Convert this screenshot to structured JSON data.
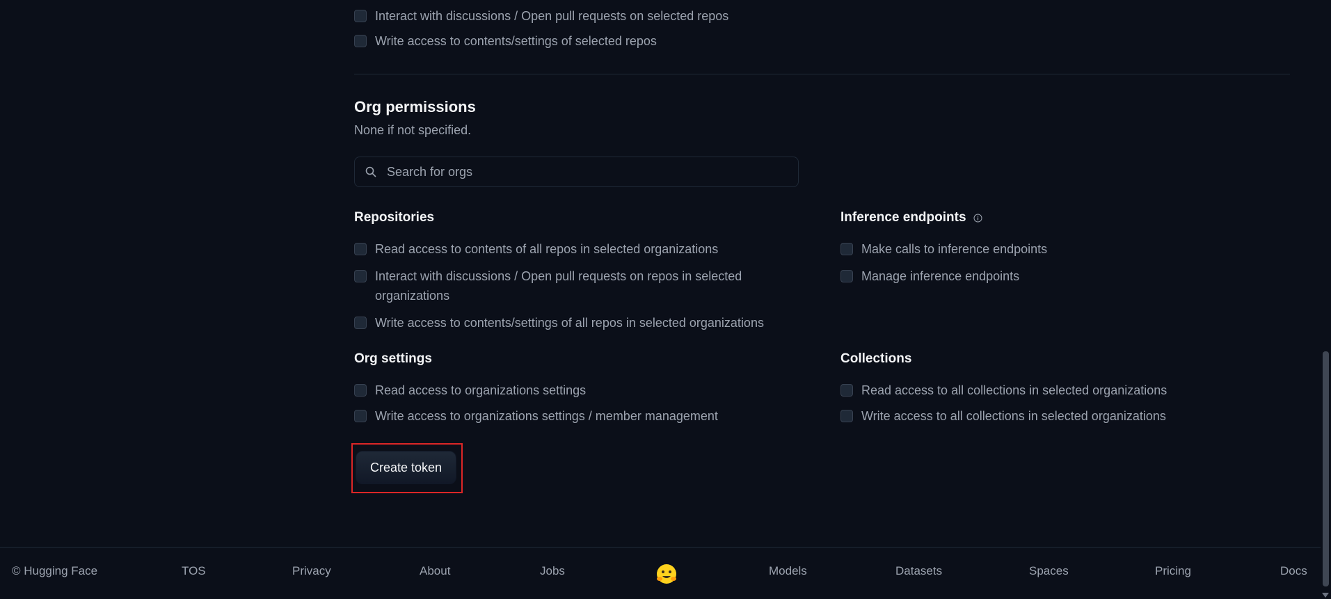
{
  "repo_permissions_tail": [
    "Interact with discussions / Open pull requests on selected repos",
    "Write access to contents/settings of selected repos"
  ],
  "org_permissions": {
    "title": "Org permissions",
    "subtitle": "None if not specified.",
    "search_placeholder": "Search for orgs"
  },
  "repositories": {
    "title": "Repositories",
    "items": [
      "Read access to contents of all repos in selected organizations",
      "Interact with discussions / Open pull requests on repos in selected organizations",
      "Write access to contents/settings of all repos in selected organizations"
    ]
  },
  "inference_endpoints": {
    "title": "Inference endpoints",
    "items": [
      "Make calls to inference endpoints",
      "Manage inference endpoints"
    ]
  },
  "org_settings": {
    "title": "Org settings",
    "items": [
      "Read access to organizations settings",
      "Write access to organizations settings / member management"
    ]
  },
  "collections": {
    "title": "Collections",
    "items": [
      "Read access to all collections in selected organizations",
      "Write access to all collections in selected organizations"
    ]
  },
  "create_button": "Create token",
  "footer": {
    "copyright": "© Hugging Face",
    "links": [
      "TOS",
      "Privacy",
      "About",
      "Jobs",
      "Models",
      "Datasets",
      "Spaces",
      "Pricing",
      "Docs"
    ],
    "logo": "🤗"
  },
  "colors": {
    "background": "#0b0f19",
    "highlight_border": "#dc2626"
  }
}
